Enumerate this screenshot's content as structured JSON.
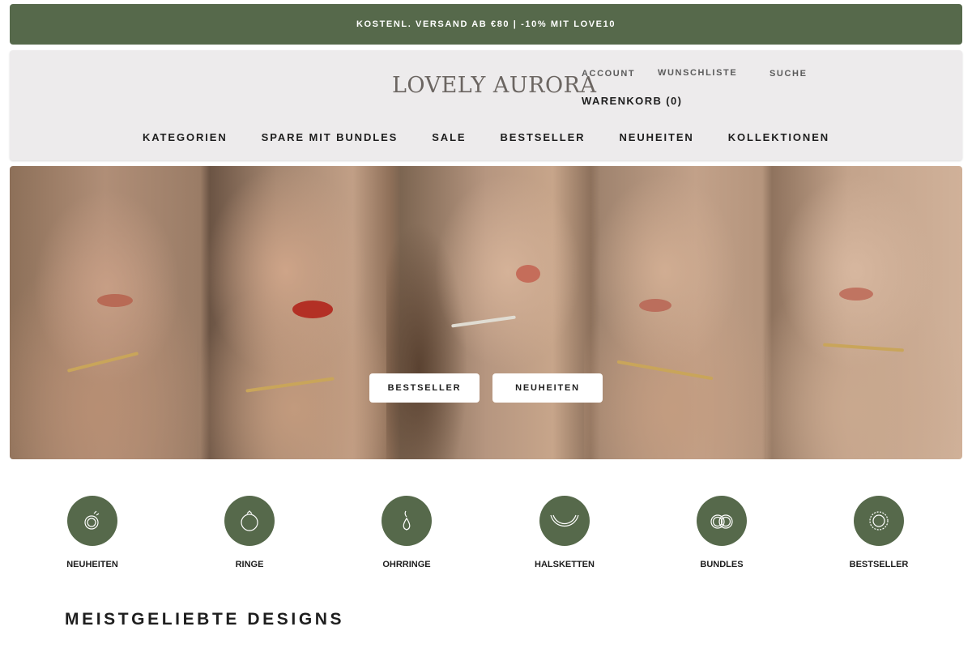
{
  "announcement": {
    "text": "KOSTENL. VERSAND AB €80 | -10% MIT LOVE10"
  },
  "header": {
    "logo": "LOVELY AURORA",
    "account": "ACCOUNT",
    "wishlist": "WUNSCHLISTE",
    "search": "SUCHE",
    "cart": "WARENKORB (0)"
  },
  "nav": {
    "items": [
      {
        "label": "KATEGORIEN"
      },
      {
        "label": "SPARE MIT BUNDLES"
      },
      {
        "label": "SALE"
      },
      {
        "label": "BESTSELLER"
      },
      {
        "label": "NEUHEITEN"
      },
      {
        "label": "KOLLEKTIONEN"
      }
    ]
  },
  "hero": {
    "buttons": [
      {
        "label": "BESTSELLER"
      },
      {
        "label": "NEUHEITEN"
      }
    ]
  },
  "categories": {
    "items": [
      {
        "label": "NEUHEITEN",
        "icon": "ring-sparkle-icon"
      },
      {
        "label": "RINGE",
        "icon": "ring-icon"
      },
      {
        "label": "OHRRINGE",
        "icon": "earring-icon"
      },
      {
        "label": "HALSKETTEN",
        "icon": "necklace-icon"
      },
      {
        "label": "BUNDLES",
        "icon": "double-ring-icon"
      },
      {
        "label": "BESTSELLER",
        "icon": "bracelet-icon"
      }
    ]
  },
  "section": {
    "title": "MEISTGELIEBTE DESIGNS"
  },
  "colors": {
    "brand_green": "#56694b",
    "header_bg": "#edebec",
    "text_dark": "#1e1e1e"
  }
}
